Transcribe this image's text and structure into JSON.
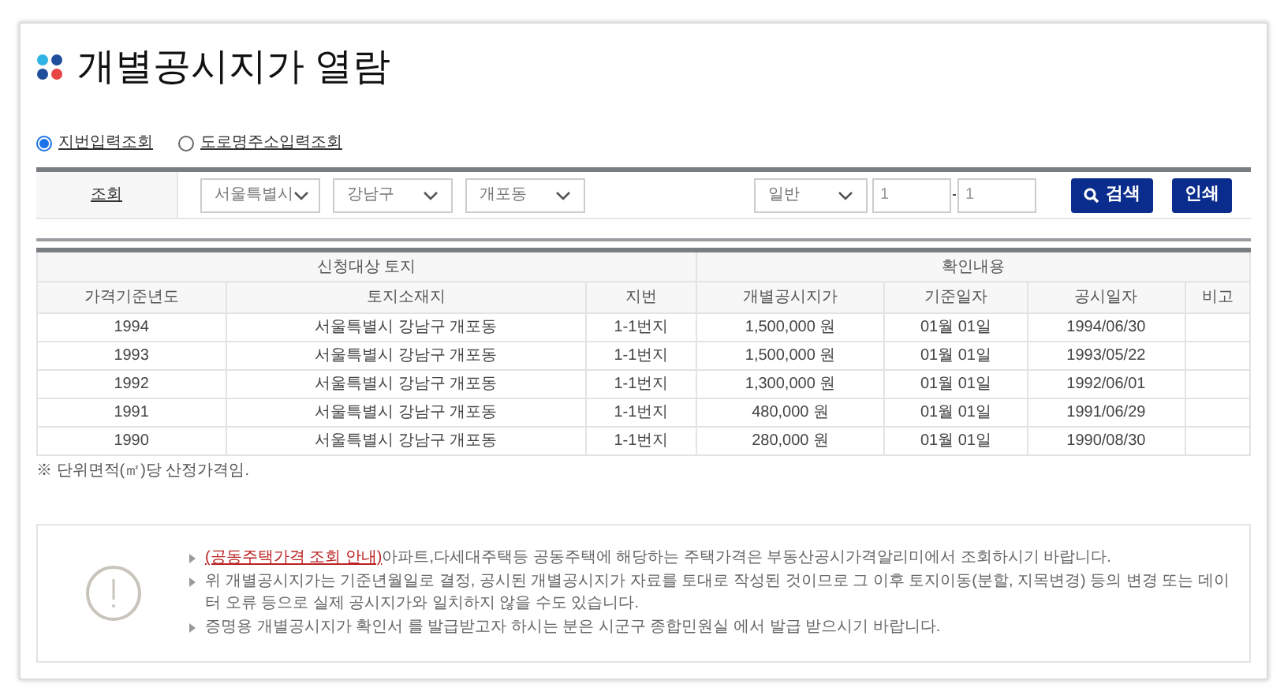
{
  "title": "개별공시지가 열람",
  "search_modes": [
    {
      "label": "지번입력조회",
      "selected": true
    },
    {
      "label": "도로명주소입력조회",
      "selected": false
    }
  ],
  "search": {
    "label": "조회",
    "selects": [
      "서울특별시",
      "강남구",
      "개포동"
    ],
    "type_select": "일반",
    "main_no": "1",
    "sub_no": "1",
    "search_button": "검색",
    "print_button": "인쇄"
  },
  "table": {
    "groups": [
      "신청대상 토지",
      "확인내용"
    ],
    "columns": [
      "가격기준년도",
      "토지소재지",
      "지번",
      "개별공시지가",
      "기준일자",
      "공시일자",
      "비고"
    ],
    "rows": [
      [
        "1994",
        "서울특별시 강남구 개포동",
        "1-1번지",
        "1,500,000 원",
        "01월 01일",
        "1994/06/30"
      ],
      [
        "1993",
        "서울특별시 강남구 개포동",
        "1-1번지",
        "1,500,000 원",
        "01월 01일",
        "1993/05/22"
      ],
      [
        "1992",
        "서울특별시 강남구 개포동",
        "1-1번지",
        "1,300,000 원",
        "01월 01일",
        "1992/06/01"
      ],
      [
        "1991",
        "서울특별시 강남구 개포동",
        "1-1번지",
        "480,000 원",
        "01월 01일",
        "1991/06/29"
      ],
      [
        "1990",
        "서울특별시 강남구 개포동",
        "1-1번지",
        "280,000 원",
        "01월 01일",
        "1990/08/30"
      ]
    ]
  },
  "unit_note": "※ 단위면적(㎡)당 산정가격임.",
  "notices": [
    {
      "link": "(공동주택가격 조회 안내)",
      "text": "아파트,다세대주택등 공동주택에 해당하는 주택가격은 부동산공시가격알리미에서 조회하시기 바랍니다."
    },
    {
      "text": "위 개별공시지가는 기준년월일로 결정, 공시된 개별공시지가 자료를 토대로 작성된 것이므로 그 이후 토지이동(분할, 지목변경) 등의 변경 또는 데이터 오류 등으로 실제 공시지가와 일치하지 않을 수도 있습니다."
    },
    {
      "text": "증명용 개별공시지가 확인서 를 발급받고자 하시는 분은 시군구 종합민원실 에서 발급 받으시기 바랍니다."
    }
  ]
}
